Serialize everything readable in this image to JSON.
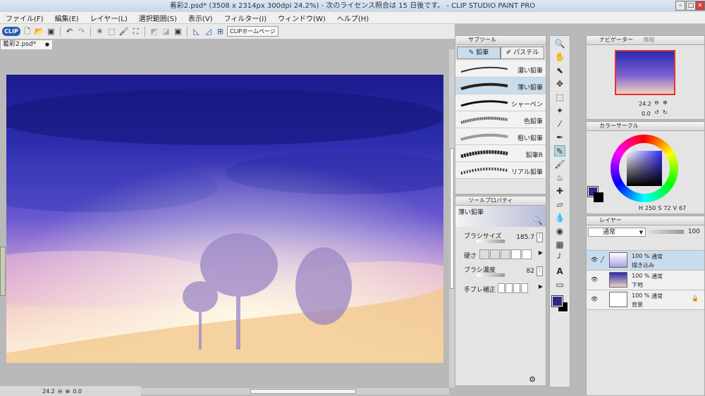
{
  "title_bar": {
    "title": "着彩2.psd* (3508 x 2314px 300dpi 24.2%)  - 次のライセンス照合は 15 日後です。 - CLIP STUDIO PAINT PRO"
  },
  "menu": [
    "ファイル(F)",
    "編集(E)",
    "レイヤー(L)",
    "選択範囲(S)",
    "表示(V)",
    "フィルター(I)",
    "ウィンドウ(W)",
    "ヘルプ(H)"
  ],
  "toolbar": {
    "logo": "CLIP",
    "clip_home": "CLIPホームページ"
  },
  "doc_tab": {
    "name": "着彩2.psd*",
    "close": "●"
  },
  "status": {
    "zoom": "24.2",
    "angle": "0.0"
  },
  "subtool": {
    "panel_title": "サブツール",
    "tabs": [
      "鉛筆",
      "パステル"
    ],
    "brushes": [
      "濃い鉛筆",
      "薄い鉛筆",
      "シャーペン",
      "色鉛筆",
      "粗い鉛筆",
      "鉛筆R",
      "リアル鉛筆"
    ]
  },
  "tool_property": {
    "panel_title": "ツールプロパティ",
    "current": "薄い鉛筆",
    "brush_size_label": "ブラシサイズ",
    "brush_size": "185.7",
    "hardness_label": "硬さ",
    "density_label": "ブラシ濃度",
    "density": "82",
    "stabilization_label": "手ブレ補正"
  },
  "navigator": {
    "tabs": [
      "ナビゲーター",
      "情報"
    ],
    "zoom": "24.2",
    "rotation": "0.0"
  },
  "color_circle": {
    "tabs": [
      "カラーサークル"
    ],
    "h": "250",
    "s": "72",
    "v": "67",
    "h_label": "H",
    "s_label": "S",
    "v_label": "V",
    "main_color": "#2d2a8a"
  },
  "layers": {
    "panel_title": "レイヤー",
    "blend_mode": "通常",
    "opacity": "100",
    "items": [
      {
        "opacity": "100 %",
        "mode": "通常",
        "name": "描き込み"
      },
      {
        "opacity": "100 %",
        "mode": "通常",
        "name": "下地"
      },
      {
        "opacity": "100 %",
        "mode": "通常",
        "name": "背景"
      }
    ]
  }
}
